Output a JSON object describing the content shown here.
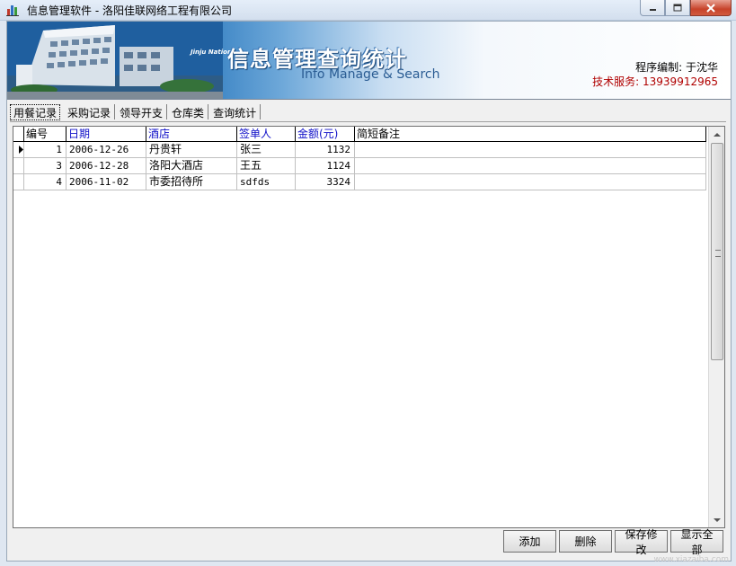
{
  "window": {
    "title": "信息管理软件 - 洛阳佳联网络工程有限公司",
    "buttons": [
      "minimize",
      "maximize",
      "close"
    ]
  },
  "banner": {
    "title": "信息管理查询统计",
    "subtitle": "Info Manage & Search",
    "building_caption": "Jinju Nationa",
    "author_line": "程序编制: 于沈华",
    "support_line": "技术服务: 13939912965",
    "support_color": "#b00000"
  },
  "tabs": [
    {
      "label": "用餐记录",
      "active": true
    },
    {
      "label": "采购记录",
      "active": false
    },
    {
      "label": "领导开支",
      "active": false
    },
    {
      "label": "仓库类",
      "active": false
    },
    {
      "label": "查询统计",
      "active": false
    }
  ],
  "grid": {
    "columns": [
      "编号",
      "日期",
      "酒店",
      "签单人",
      "金额(元)",
      "简短备注"
    ],
    "rows": [
      [
        "1",
        "2006-12-26",
        "丹贵轩",
        "张三",
        "1132",
        ""
      ],
      [
        "3",
        "2006-12-28",
        "洛阳大酒店",
        "王五",
        "1124",
        ""
      ],
      [
        "4",
        "2006-11-02",
        "市委招待所",
        "sdfds",
        "3324",
        ""
      ]
    ],
    "current_row_marker": "▶"
  },
  "actions": {
    "add": "添加",
    "delete": "删除",
    "save": "保存修改",
    "show_all": "显示全部"
  },
  "watermark": "www.xiazaiba.com"
}
